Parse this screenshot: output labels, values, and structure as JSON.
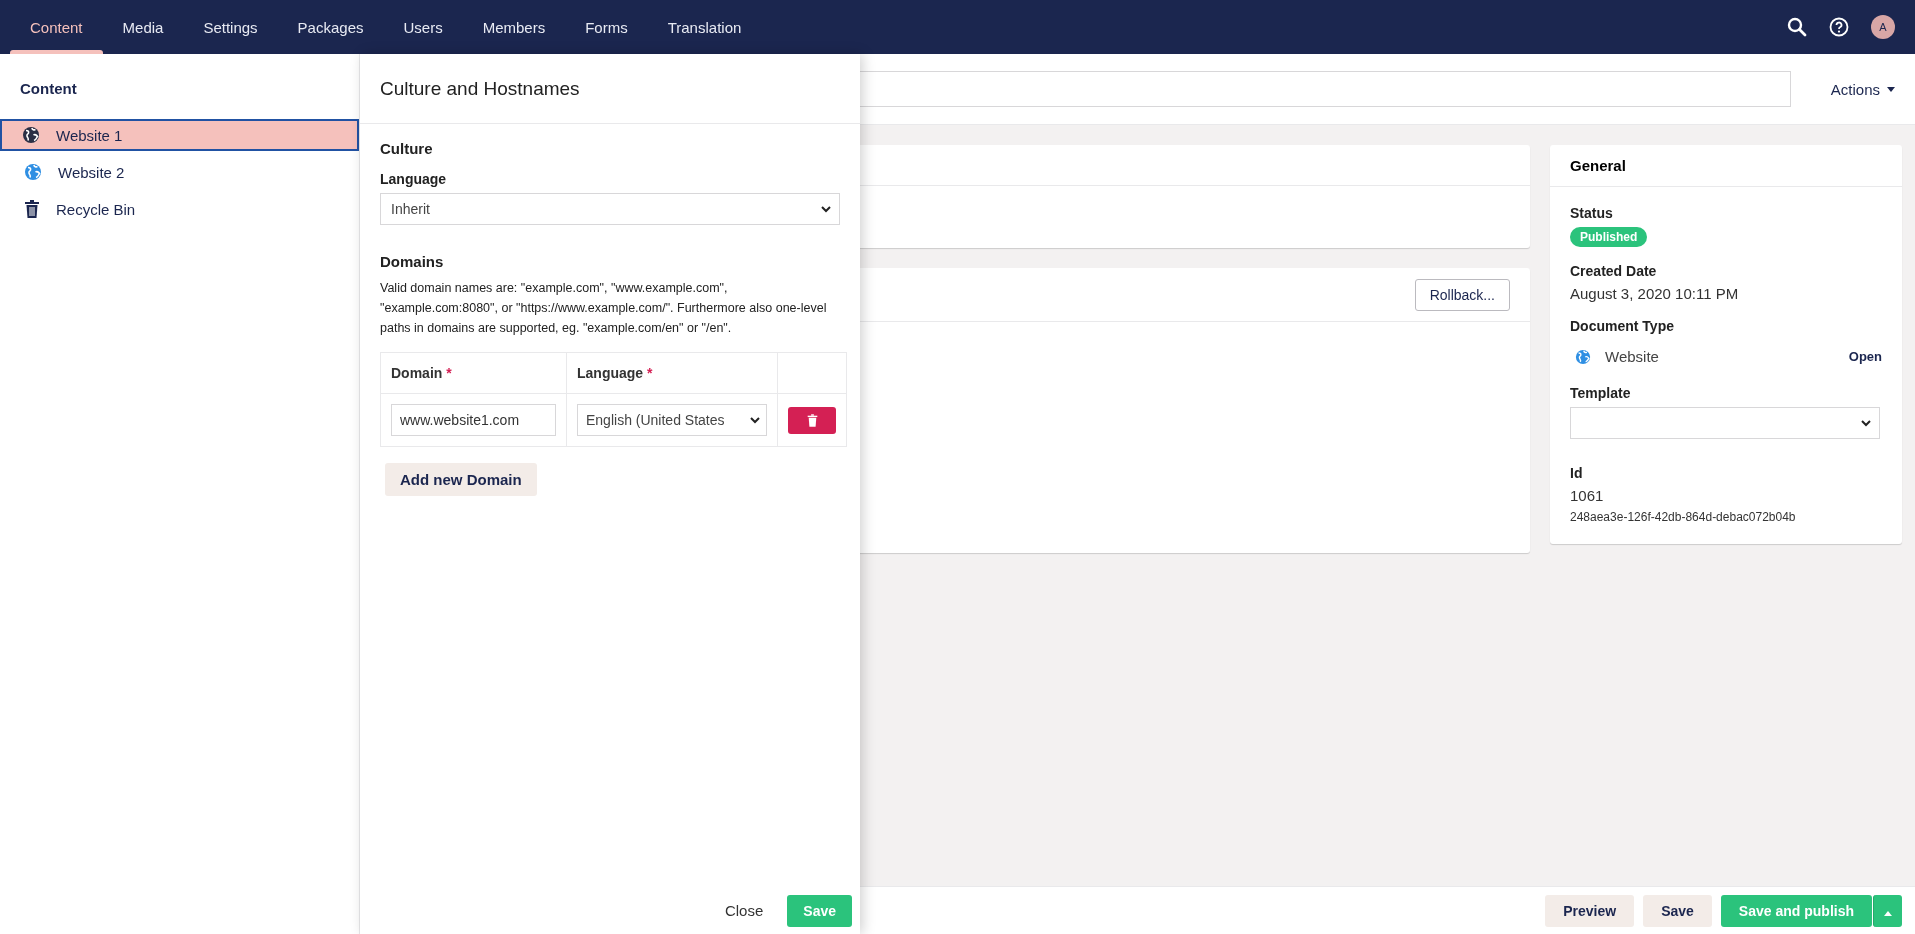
{
  "top_nav": {
    "sections": [
      {
        "label": "Content",
        "selected": true
      },
      {
        "label": "Media",
        "selected": false
      },
      {
        "label": "Settings",
        "selected": false
      },
      {
        "label": "Packages",
        "selected": false
      },
      {
        "label": "Users",
        "selected": false
      },
      {
        "label": "Members",
        "selected": false
      },
      {
        "label": "Forms",
        "selected": false
      },
      {
        "label": "Translation",
        "selected": false
      }
    ],
    "avatar_initial": "A"
  },
  "tree": {
    "title": "Content",
    "items": [
      {
        "label": "Website 1",
        "kind": "globe",
        "selected": true
      },
      {
        "label": "Website 2",
        "kind": "globe",
        "selected": false
      },
      {
        "label": "Recycle Bin",
        "kind": "bin",
        "selected": false
      }
    ]
  },
  "editor": {
    "actions_label": "Actions",
    "rollback_label": "Rollback...",
    "general": {
      "title": "General",
      "status_label": "Status",
      "status": "Published",
      "created_label": "Created Date",
      "created": "August 3, 2020 10:11 PM",
      "doctype_label": "Document Type",
      "doctype": "Website",
      "open_label": "Open",
      "template_label": "Template",
      "id_label": "Id",
      "id": "1061",
      "guid": "248aea3e-126f-42db-864d-debac072b04b"
    },
    "footer_buttons": [
      {
        "label": "Preview",
        "kind": "secondary"
      },
      {
        "label": "Save",
        "kind": "secondary"
      },
      {
        "label": "Save and publish",
        "kind": "primary"
      }
    ]
  },
  "dialog": {
    "title": "Culture and Hostnames",
    "culture_heading": "Culture",
    "language_label": "Language",
    "language_value": "Inherit",
    "domains_heading": "Domains",
    "help": "Valid domain names are: \"example.com\", \"www.example.com\", \"example.com:8080\", or \"https://www.example.com/\". Furthermore also one-level paths in domains are supported, eg. \"example.com/en\" or \"/en\".",
    "columns": [
      {
        "label": "Domain",
        "required_mark": "*"
      },
      {
        "label": "Language",
        "required_mark": "*"
      }
    ],
    "rows": [
      {
        "domain": "www.website1.com",
        "language": "English (United States"
      }
    ],
    "add_label": "Add new Domain",
    "close_label": "Close",
    "save_label": "Save"
  }
}
